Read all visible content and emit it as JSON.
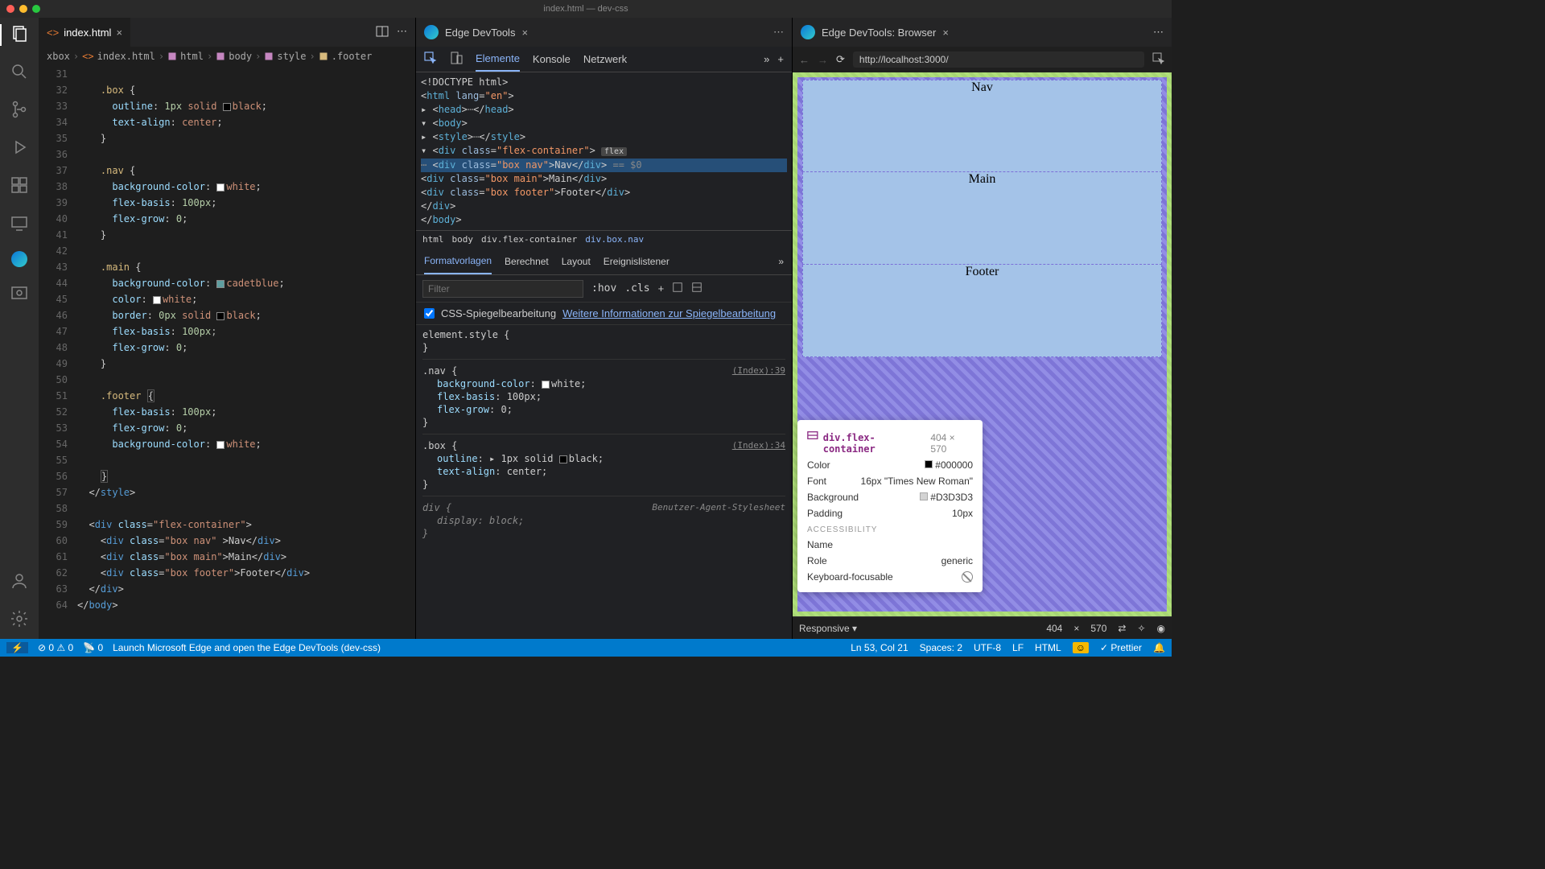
{
  "title": "index.html — dev-css",
  "activityIcons": [
    "files",
    "search",
    "git",
    "debug",
    "extensions",
    "remote",
    "edge",
    "screenshot"
  ],
  "editor": {
    "tab": "index.html",
    "breadcrumb": [
      "xbox",
      "index.html",
      "html",
      "body",
      "style",
      ".footer"
    ],
    "lines": [
      31,
      32,
      33,
      34,
      35,
      36,
      37,
      38,
      39,
      40,
      41,
      42,
      43,
      44,
      45,
      46,
      47,
      48,
      49,
      50,
      51,
      52,
      53,
      54,
      55,
      56,
      57,
      58,
      59,
      60,
      61,
      62,
      63,
      64
    ]
  },
  "devtools": {
    "title": "Edge DevTools",
    "tabs": [
      "Elemente",
      "Konsole",
      "Netzwerk"
    ],
    "activeTab": "Elemente",
    "breadcrumb": [
      "html",
      "body",
      "div.flex-container",
      "div.box.nav"
    ],
    "panes": [
      "Formatvorlagen",
      "Berechnet",
      "Layout",
      "Ereignislistener"
    ],
    "activePane": "Formatvorlagen",
    "filterPlaceholder": "Filter",
    "hov": ":hov",
    "cls": ".cls",
    "cssMirror": "CSS-Spiegelbearbeitung",
    "cssMirrorLink": "Weitere Informationen zur Spiegelbearbeitung",
    "elementStyle": "element.style {",
    "navRuleSrc": "(Index):39",
    "boxRuleSrc": "(Index):34",
    "uaStyle": "Benutzer-Agent-Stylesheet"
  },
  "browser": {
    "title": "Edge DevTools: Browser",
    "url": "http://localhost:3000/",
    "nav": "Nav",
    "main": "Main",
    "footer": "Footer",
    "responsive": "Responsive",
    "width": "404",
    "height": "570"
  },
  "tooltip": {
    "selector": "div.flex-container",
    "dims": "404 × 570",
    "colorLabel": "Color",
    "color": "#000000",
    "fontLabel": "Font",
    "font": "16px \"Times New Roman\"",
    "bgLabel": "Background",
    "bg": "#D3D3D3",
    "padLabel": "Padding",
    "pad": "10px",
    "acc": "ACCESSIBILITY",
    "nameLabel": "Name",
    "name": "",
    "roleLabel": "Role",
    "role": "generic",
    "kbLabel": "Keyboard-focusable"
  },
  "status": {
    "remote": "",
    "errors": "0",
    "warnings": "0",
    "ports": "0",
    "launch": "Launch Microsoft Edge and open the Edge DevTools (dev-css)",
    "lncol": "Ln 53, Col 21",
    "spaces": "Spaces: 2",
    "encoding": "UTF-8",
    "eol": "LF",
    "lang": "HTML",
    "prettier": "Prettier"
  }
}
